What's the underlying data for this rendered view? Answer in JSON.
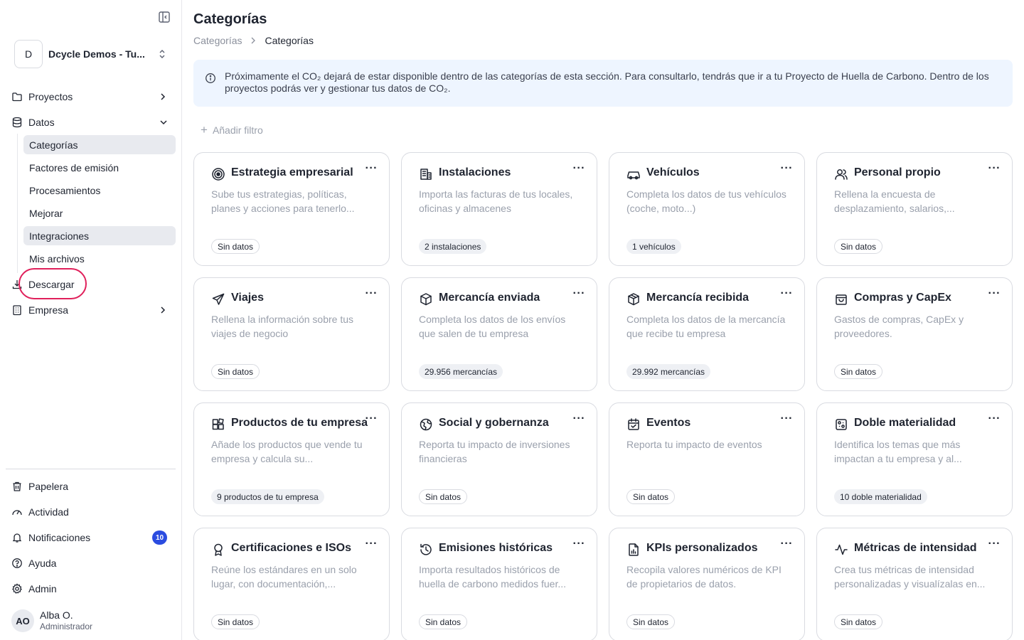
{
  "org": {
    "avatar": "D",
    "name": "Dcycle Demos - Tu..."
  },
  "nav": {
    "proyectos": "Proyectos",
    "datos": "Datos",
    "sub": [
      "Categorías",
      "Factores de emisión",
      "Procesamientos",
      "Mejorar",
      "Integraciones",
      "Mis archivos"
    ],
    "descargar": "Descargar",
    "empresa": "Empresa",
    "papelera": "Papelera",
    "actividad": "Actividad",
    "notificaciones": "Notificaciones",
    "notif_count": "10",
    "ayuda": "Ayuda",
    "admin": "Admin"
  },
  "user": {
    "initials": "AO",
    "name": "Alba O.",
    "role": "Administrador"
  },
  "page": {
    "title": "Categorías",
    "breadcrumb": [
      "Categorías",
      "Categorías"
    ],
    "banner": "Próximamente el CO₂ dejará de estar disponible dentro de las categorías de esta sección. Para consultarlo, tendrás que ir a tu Proyecto de Huella de Carbono. Dentro de los proyectos podrás ver y gestionar tus datos de CO₂.",
    "add_filter": "Añadir filtro"
  },
  "cards": [
    {
      "icon": "target-icon",
      "title": "Estrategia empresarial",
      "desc": "Sube tus estrategias, políticas, planes y acciones para tenerlo...",
      "badge": "Sin datos"
    },
    {
      "icon": "building-icon",
      "title": "Instalaciones",
      "desc": "Importa las facturas de tus locales, oficinas y almacenes",
      "badge": "2 instalaciones"
    },
    {
      "icon": "car-icon",
      "title": "Vehículos",
      "desc": "Completa los datos de tus vehículos (coche, moto...)",
      "badge": "1 vehículos"
    },
    {
      "icon": "users-icon",
      "title": "Personal propio",
      "desc": "Rellena la encuesta de desplazamiento, salarios,...",
      "badge": "Sin datos"
    },
    {
      "icon": "plane-icon",
      "title": "Viajes",
      "desc": "Rellena la información sobre tus viajes de negocio",
      "badge": "Sin datos"
    },
    {
      "icon": "package-icon",
      "title": "Mercancía enviada",
      "desc": "Completa los datos de los envíos que salen de tu empresa",
      "badge": "29.956 mercancías"
    },
    {
      "icon": "package-received-icon",
      "title": "Mercancía recibida",
      "desc": "Completa los datos de la mercancía que recibe tu empresa",
      "badge": "29.992 mercancías"
    },
    {
      "icon": "shopping-bag-icon",
      "title": "Compras y CapEx",
      "desc": "Gastos de compras, CapEx y proveedores.",
      "badge": "Sin datos"
    },
    {
      "icon": "products-icon",
      "title": "Productos de tu empresa",
      "desc": "Añade los productos que vende tu empresa y calcula su...",
      "badge": "9 productos de tu empresa"
    },
    {
      "icon": "globe-icon",
      "title": "Social y gobernanza",
      "desc": "Reporta tu impacto de inversiones financieras",
      "badge": "Sin datos"
    },
    {
      "icon": "calendar-icon",
      "title": "Eventos",
      "desc": "Reporta tu impacto de eventos",
      "badge": "Sin datos"
    },
    {
      "icon": "materiality-icon",
      "title": "Doble materialidad",
      "desc": "Identifica los temas que más impactan a tu empresa y al...",
      "badge": "10 doble materialidad"
    },
    {
      "icon": "award-icon",
      "title": "Certificaciones e ISOs",
      "desc": "Reúne los estándares en un solo lugar, con documentación,...",
      "badge": "Sin datos"
    },
    {
      "icon": "history-icon",
      "title": "Emisiones históricas",
      "desc": "Importa resultados históricos de huella de carbono medidos fuer...",
      "badge": "Sin datos"
    },
    {
      "icon": "file-chart-icon",
      "title": "KPIs personalizados",
      "desc": "Recopila valores numéricos de KPI de propietarios de datos.",
      "badge": "Sin datos"
    },
    {
      "icon": "activity-icon",
      "title": "Métricas de intensidad",
      "desc": "Crea tus métricas de intensidad personalizadas y visualízalas en...",
      "badge": "Sin datos"
    }
  ],
  "card_more": "···"
}
